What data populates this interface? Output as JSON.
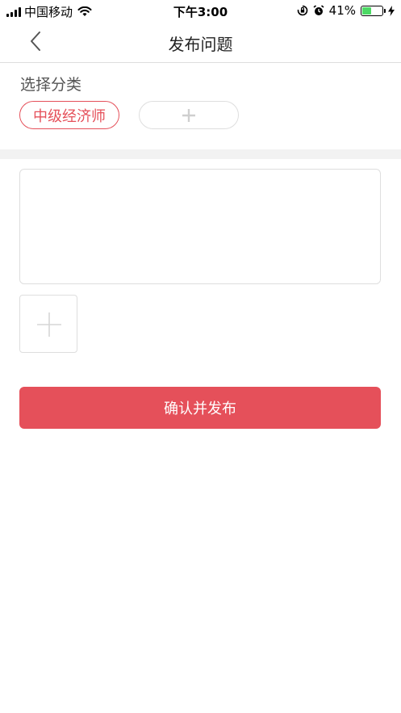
{
  "status_bar": {
    "carrier": "中国移动",
    "time": "下午3:00",
    "battery_text": "41%",
    "battery_level": 0.41
  },
  "nav": {
    "title": "发布问题"
  },
  "category": {
    "label": "选择分类",
    "selected": "中级经济师",
    "add_symbol": "+"
  },
  "content": {
    "text_value": ""
  },
  "actions": {
    "publish_label": "确认并发布"
  },
  "colors": {
    "accent": "#e5505a",
    "divider": "#f2f2f2",
    "border": "#dedede"
  }
}
